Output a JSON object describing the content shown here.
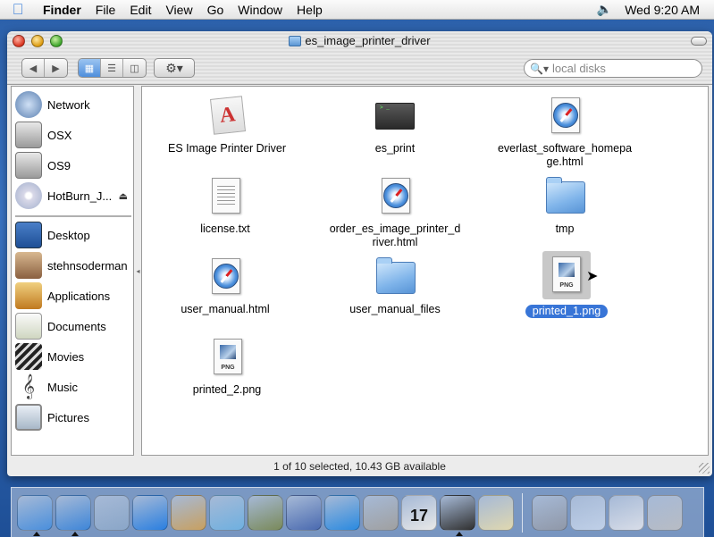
{
  "menubar": {
    "apple_glyph": "",
    "app_name": "Finder",
    "menus": [
      "File",
      "Edit",
      "View",
      "Go",
      "Window",
      "Help"
    ],
    "clock": "Wed 9:20 AM"
  },
  "window": {
    "title": "es_image_printer_driver",
    "search_placeholder": "local disks",
    "status": "1 of 10 selected, 10.43 GB available"
  },
  "sidebar": {
    "devices": [
      {
        "label": "Network",
        "icon": "network-globe-icon"
      },
      {
        "label": "OSX",
        "icon": "hard-drive-icon"
      },
      {
        "label": "OS9",
        "icon": "hard-drive-icon"
      },
      {
        "label": "HotBurn_J...",
        "icon": "cd-disc-icon"
      }
    ],
    "places": [
      {
        "label": "Desktop",
        "icon": "desktop-icon"
      },
      {
        "label": "stehnsoderman",
        "icon": "home-icon"
      },
      {
        "label": "Applications",
        "icon": "applications-icon"
      },
      {
        "label": "Documents",
        "icon": "documents-icon"
      },
      {
        "label": "Movies",
        "icon": "movies-icon"
      },
      {
        "label": "Music",
        "icon": "music-icon"
      },
      {
        "label": "Pictures",
        "icon": "pictures-icon"
      }
    ]
  },
  "files": [
    {
      "name": "ES Image Printer Driver",
      "kind": "app",
      "selected": false
    },
    {
      "name": "es_print",
      "kind": "terminal",
      "selected": false
    },
    {
      "name": "everlast_software_homepage.html",
      "kind": "safari",
      "selected": false
    },
    {
      "name": "license.txt",
      "kind": "text",
      "selected": false
    },
    {
      "name": "order_es_image_printer_driver.html",
      "kind": "safari",
      "selected": false
    },
    {
      "name": "tmp",
      "kind": "folder",
      "selected": false
    },
    {
      "name": "user_manual.html",
      "kind": "safari",
      "selected": false
    },
    {
      "name": "user_manual_files",
      "kind": "folder",
      "selected": false
    },
    {
      "name": "printed_1.png",
      "kind": "png",
      "selected": true
    },
    {
      "name": "printed_2.png",
      "kind": "png",
      "selected": false
    }
  ],
  "file_display": {
    "everlast": [
      "everlast_software_homepa",
      "ge.html"
    ],
    "order": [
      "order_es_image_printer_d",
      "river.html"
    ]
  },
  "dock": [
    {
      "name": "finder-icon",
      "color": "#4a8fdc"
    },
    {
      "name": "safari-icon",
      "color": "#3e86d8"
    },
    {
      "name": "mail-icon",
      "color": "#8aa6c8"
    },
    {
      "name": "ichat-icon",
      "color": "#2a7fe0"
    },
    {
      "name": "address-book-icon",
      "color": "#c8a060"
    },
    {
      "name": "itunes-icon",
      "color": "#6fb0e0"
    },
    {
      "name": "iphoto-icon",
      "color": "#7a8a5a"
    },
    {
      "name": "imovie-icon",
      "color": "#4a6ab0"
    },
    {
      "name": "quicktime-icon",
      "color": "#2a8ae0"
    },
    {
      "name": "system-preferences-icon",
      "color": "#a0a0a0"
    },
    {
      "name": "ical-icon",
      "color": "#e8e8e8"
    },
    {
      "name": "terminal-icon",
      "color": "#303030"
    },
    {
      "name": "textedit-icon",
      "color": "#e0d8b0"
    },
    {
      "name": "internet-connect-icon",
      "color": "#9098a8"
    },
    {
      "name": "minimized-window-icon",
      "color": "#c0d0e8"
    },
    {
      "name": "minimized-window-icon",
      "color": "#d8dde8"
    },
    {
      "name": "trash-icon",
      "color": "#b8bcc4"
    }
  ],
  "dock_ical_day": "17"
}
